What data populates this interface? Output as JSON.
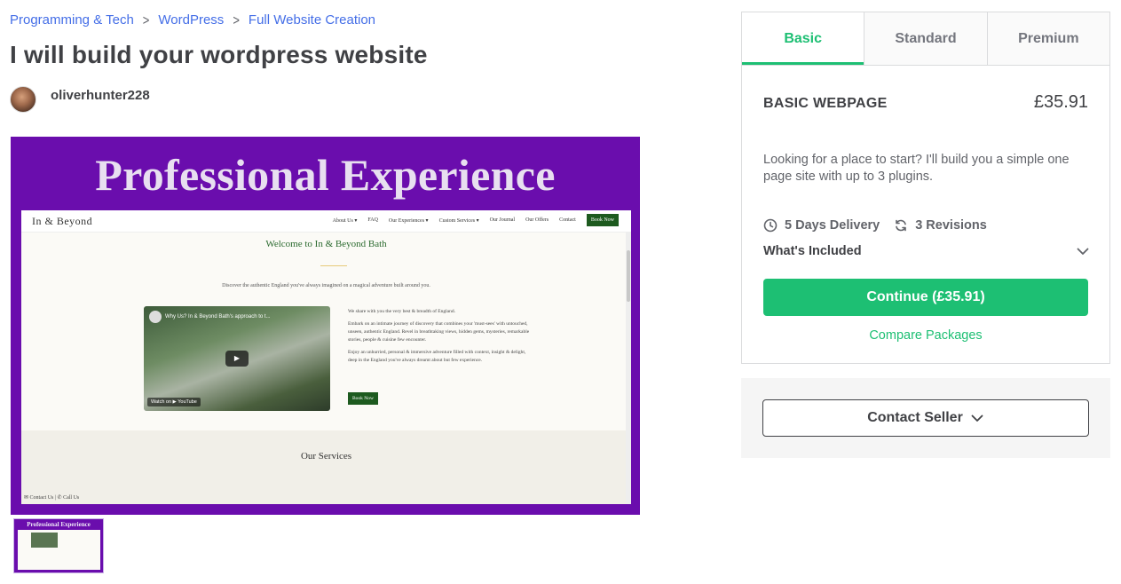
{
  "breadcrumb": {
    "items": [
      "Programming & Tech",
      "WordPress",
      "Full Website Creation"
    ],
    "separator": ">"
  },
  "gig": {
    "title": "I will build your wordpress website",
    "seller_name": "oliverhunter228"
  },
  "gallery": {
    "headline": "Professional Experience",
    "screenshot": {
      "logo": "In & Beyond",
      "menu": [
        "About Us ▾",
        "FAQ",
        "Our Experiences ▾",
        "Custom Services ▾",
        "Our Journal",
        "Our Offers",
        "Contact"
      ],
      "menu_button": "Book Now",
      "welcome": "Welcome to In & Beyond Bath",
      "discover": "Discover the authentic England you've always imagined on a magical adventure built around you.",
      "video_title": "Why Us? In & Beyond Bath's approach to t...",
      "video_watch": "Watch on ▶ YouTube",
      "paragraphs": [
        "We share with you the very best & breadth of England.",
        "Embark on an intimate journey of discovery that combines your 'must-sees' with untouched, unseen, authentic England. Revel in breathtaking views, hidden gems, mysteries, remarkable stories, people & cuisine few encounter.",
        "Enjoy an unhurried, personal & immersive adventure filled with context, insight & delight, deep in the England you've always dreamt about but few experience."
      ],
      "book_button": "Book Now",
      "services": "Our Services",
      "contact_bar": "✉ Contact Us | ✆ Call Us"
    },
    "thumbnail_title": "Professional Experience"
  },
  "package": {
    "tabs": [
      {
        "label": "Basic",
        "active": true
      },
      {
        "label": "Standard",
        "active": false
      },
      {
        "label": "Premium",
        "active": false
      }
    ],
    "name": "BASIC WEBPAGE",
    "price": "£35.91",
    "description": "Looking for a place to start? I'll build you a simple one page site with up to 3 plugins.",
    "delivery": "5 Days Delivery",
    "revisions": "3 Revisions",
    "whats_included": "What's Included",
    "continue_label": "Continue (£35.91)",
    "compare_label": "Compare Packages",
    "contact_label": "Contact Seller"
  },
  "colors": {
    "accent_green": "#1dbf73",
    "link_blue": "#446ee7",
    "gallery_purple": "#6a0dad",
    "text_dark": "#404145"
  }
}
